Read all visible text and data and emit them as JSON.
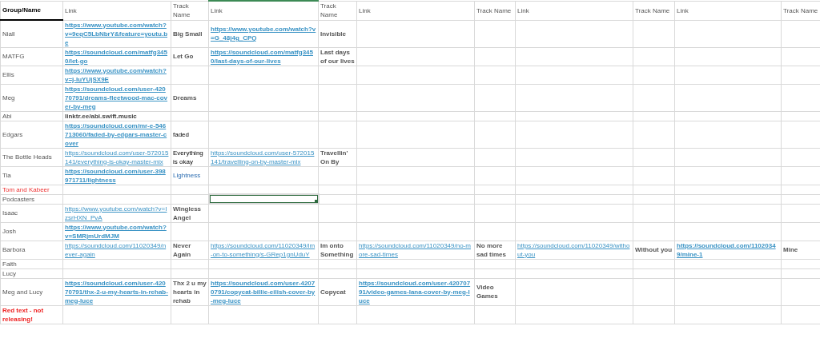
{
  "columns": [
    {
      "label": "Group/Name",
      "selected": false
    },
    {
      "label": "Link",
      "selected": false
    },
    {
      "label": "Track Name",
      "selected": false
    },
    {
      "label": "Link",
      "selected": true
    },
    {
      "label": "Track Name",
      "selected": false
    },
    {
      "label": "Link",
      "selected": false
    },
    {
      "label": "Track Name",
      "selected": false
    },
    {
      "label": "Link",
      "selected": false
    },
    {
      "label": "Track Name",
      "selected": false
    },
    {
      "label": "Link",
      "selected": false
    },
    {
      "label": "Track Name",
      "selected": false
    }
  ],
  "rows": [
    {
      "cells": [
        {
          "kind": "name",
          "text": "Niall",
          "selected": false
        },
        {
          "kind": "link_bold",
          "text": "https://www.youtube.com/watch?v=9eqC5LbNbrY&feature=youtu.be",
          "selected": false
        },
        {
          "kind": "track",
          "text": "Big Small",
          "selected": false
        },
        {
          "kind": "link_bold",
          "text": "https://www.youtube.com/watch?v=G_48j4g_CPQ",
          "selected": false
        },
        {
          "kind": "track",
          "text": "Invisible",
          "selected": false
        },
        {
          "kind": "empty",
          "selected": false
        },
        {
          "kind": "empty",
          "selected": false
        },
        {
          "kind": "empty",
          "selected": false
        },
        {
          "kind": "empty",
          "selected": false
        },
        {
          "kind": "empty",
          "selected": false
        },
        {
          "kind": "empty",
          "selected": false
        }
      ]
    },
    {
      "cells": [
        {
          "kind": "name",
          "text": "MATFG",
          "selected": false
        },
        {
          "kind": "link_bold",
          "text": "https://soundcloud.com/matfg3450/let-go",
          "selected": false
        },
        {
          "kind": "track",
          "text": "Let Go",
          "selected": false
        },
        {
          "kind": "link_bold",
          "text": "https://soundcloud.com/matfg3450/last-days-of-our-lives",
          "selected": false
        },
        {
          "kind": "track",
          "text": "Last days of our lives",
          "selected": false
        },
        {
          "kind": "empty",
          "selected": false
        },
        {
          "kind": "empty",
          "selected": false
        },
        {
          "kind": "empty",
          "selected": false
        },
        {
          "kind": "empty",
          "selected": false
        },
        {
          "kind": "empty",
          "selected": false
        },
        {
          "kind": "empty",
          "selected": false
        }
      ]
    },
    {
      "cells": [
        {
          "kind": "name",
          "text": "Ellis",
          "selected": false
        },
        {
          "kind": "link_bold",
          "text": "https://www.youtube.com/watch?v=j-IuYUjSX9E",
          "selected": false
        },
        {
          "kind": "empty",
          "selected": false
        },
        {
          "kind": "empty",
          "selected": false
        },
        {
          "kind": "empty",
          "selected": false
        },
        {
          "kind": "empty",
          "selected": false
        },
        {
          "kind": "empty",
          "selected": false
        },
        {
          "kind": "empty",
          "selected": false
        },
        {
          "kind": "empty",
          "selected": false
        },
        {
          "kind": "empty",
          "selected": false
        },
        {
          "kind": "empty",
          "selected": false
        }
      ]
    },
    {
      "cells": [
        {
          "kind": "name",
          "text": "Meg",
          "selected": false
        },
        {
          "kind": "link_bold",
          "text": "https://soundcloud.com/user-42070791/dreams-fleetwood-mac-cover-by-meg",
          "selected": false
        },
        {
          "kind": "track",
          "text": "Dreams",
          "selected": false
        },
        {
          "kind": "empty",
          "selected": false
        },
        {
          "kind": "empty",
          "selected": false
        },
        {
          "kind": "empty",
          "selected": false
        },
        {
          "kind": "empty",
          "selected": false
        },
        {
          "kind": "empty",
          "selected": false
        },
        {
          "kind": "empty",
          "selected": false
        },
        {
          "kind": "empty",
          "selected": false
        },
        {
          "kind": "empty",
          "selected": false
        }
      ]
    },
    {
      "cells": [
        {
          "kind": "name",
          "text": "Abi",
          "selected": false
        },
        {
          "kind": "text_bold",
          "text": "linktr.ee/abi.swift.music",
          "selected": false
        },
        {
          "kind": "empty",
          "selected": false
        },
        {
          "kind": "empty",
          "selected": false
        },
        {
          "kind": "empty",
          "selected": false
        },
        {
          "kind": "empty",
          "selected": false
        },
        {
          "kind": "empty",
          "selected": false
        },
        {
          "kind": "empty",
          "selected": false
        },
        {
          "kind": "empty",
          "selected": false
        },
        {
          "kind": "empty",
          "selected": false
        },
        {
          "kind": "empty",
          "selected": false
        }
      ]
    },
    {
      "cells": [
        {
          "kind": "name",
          "text": "Edgars",
          "selected": false
        },
        {
          "kind": "link_bold",
          "text": "https://soundcloud.com/mr-e-546713060/faded-by-edgars-master-cover",
          "selected": false
        },
        {
          "kind": "text",
          "text": "faded",
          "selected": false
        },
        {
          "kind": "empty",
          "selected": false
        },
        {
          "kind": "empty",
          "selected": false
        },
        {
          "kind": "empty",
          "selected": false
        },
        {
          "kind": "empty",
          "selected": false
        },
        {
          "kind": "empty",
          "selected": false
        },
        {
          "kind": "empty",
          "selected": false
        },
        {
          "kind": "empty",
          "selected": false
        },
        {
          "kind": "empty",
          "selected": false
        }
      ]
    },
    {
      "cells": [
        {
          "kind": "name",
          "text": "The Bottle Heads",
          "selected": false
        },
        {
          "kind": "link",
          "text": "https://soundcloud.com/user-572015141/everything-is-okay-master-mix",
          "selected": false
        },
        {
          "kind": "text",
          "text": "Everything is okay",
          "selected": false
        },
        {
          "kind": "link",
          "text": "https://soundcloud.com/user-572015141/travelling-on-by-master-mix",
          "selected": false
        },
        {
          "kind": "track",
          "text": "Travellin' On By",
          "selected": false
        },
        {
          "kind": "empty",
          "selected": false
        },
        {
          "kind": "empty",
          "selected": false
        },
        {
          "kind": "empty",
          "selected": false
        },
        {
          "kind": "empty",
          "selected": false
        },
        {
          "kind": "empty",
          "selected": false
        },
        {
          "kind": "empty",
          "selected": false
        }
      ]
    },
    {
      "cells": [
        {
          "kind": "name",
          "text": "Tia",
          "selected": false
        },
        {
          "kind": "link_bold",
          "text": "https://soundcloud.com/user-398971711/lightness",
          "selected": false
        },
        {
          "kind": "text_blue",
          "text": "Lightness",
          "selected": false
        },
        {
          "kind": "empty",
          "selected": false
        },
        {
          "kind": "empty",
          "selected": false
        },
        {
          "kind": "empty",
          "selected": false
        },
        {
          "kind": "empty",
          "selected": false
        },
        {
          "kind": "empty",
          "selected": false
        },
        {
          "kind": "empty",
          "selected": false
        },
        {
          "kind": "empty",
          "selected": false
        },
        {
          "kind": "empty",
          "selected": false
        }
      ]
    },
    {
      "cells": [
        {
          "kind": "name_red",
          "text": "Tom and Kabeer",
          "selected": false
        },
        {
          "kind": "empty",
          "selected": false
        },
        {
          "kind": "empty",
          "selected": false
        },
        {
          "kind": "empty",
          "selected": false
        },
        {
          "kind": "empty",
          "selected": false
        },
        {
          "kind": "empty",
          "selected": false
        },
        {
          "kind": "empty",
          "selected": false
        },
        {
          "kind": "empty",
          "selected": false
        },
        {
          "kind": "empty",
          "selected": false
        },
        {
          "kind": "empty",
          "selected": false
        },
        {
          "kind": "empty",
          "selected": false
        }
      ]
    },
    {
      "cells": [
        {
          "kind": "name",
          "text": "Podcasters",
          "selected": false
        },
        {
          "kind": "empty",
          "selected": false
        },
        {
          "kind": "empty",
          "selected": false
        },
        {
          "kind": "empty",
          "selected": true
        },
        {
          "kind": "empty",
          "selected": false
        },
        {
          "kind": "empty",
          "selected": false
        },
        {
          "kind": "empty",
          "selected": false
        },
        {
          "kind": "empty",
          "selected": false
        },
        {
          "kind": "empty",
          "selected": false
        },
        {
          "kind": "empty",
          "selected": false
        },
        {
          "kind": "empty",
          "selected": false
        }
      ]
    },
    {
      "cells": [
        {
          "kind": "name",
          "text": "Isaac",
          "selected": false
        },
        {
          "kind": "link",
          "text": "https://www.youtube.com/watch?v=IzsrHXN_PvA",
          "selected": false
        },
        {
          "kind": "track",
          "text": "Wingless Angel",
          "selected": false
        },
        {
          "kind": "empty",
          "selected": false
        },
        {
          "kind": "empty",
          "selected": false
        },
        {
          "kind": "empty",
          "selected": false
        },
        {
          "kind": "empty",
          "selected": false
        },
        {
          "kind": "empty",
          "selected": false
        },
        {
          "kind": "empty",
          "selected": false
        },
        {
          "kind": "empty",
          "selected": false
        },
        {
          "kind": "empty",
          "selected": false
        }
      ]
    },
    {
      "cells": [
        {
          "kind": "name",
          "text": "Josh",
          "selected": false
        },
        {
          "kind": "link_bold",
          "text": "https://www.youtube.com/watch?v=SMRjmUrdMJM",
          "selected": false
        },
        {
          "kind": "empty",
          "selected": false
        },
        {
          "kind": "empty",
          "selected": false
        },
        {
          "kind": "empty",
          "selected": false
        },
        {
          "kind": "empty",
          "selected": false
        },
        {
          "kind": "empty",
          "selected": false
        },
        {
          "kind": "empty",
          "selected": false
        },
        {
          "kind": "empty",
          "selected": false
        },
        {
          "kind": "empty",
          "selected": false
        },
        {
          "kind": "empty",
          "selected": false
        }
      ]
    },
    {
      "cells": [
        {
          "kind": "name",
          "text": "Barbora",
          "selected": false
        },
        {
          "kind": "link",
          "text": "https://soundcloud.com/11020349/never-again",
          "selected": false
        },
        {
          "kind": "track",
          "text": "Never Again",
          "selected": false
        },
        {
          "kind": "link",
          "text": "https://soundcloud.com/11020349/im-on-to-something/s-GRep1gnUduY",
          "selected": false
        },
        {
          "kind": "track",
          "text": "Im onto Something",
          "selected": false
        },
        {
          "kind": "link",
          "text": "https://soundcloud.com/11020349/no-more-sad-times",
          "selected": false
        },
        {
          "kind": "track",
          "text": "No more sad times",
          "selected": false
        },
        {
          "kind": "link",
          "text": "https://soundcloud.com/11020349/without-you",
          "selected": false
        },
        {
          "kind": "track",
          "text": "Without you",
          "selected": false
        },
        {
          "kind": "link_bold",
          "text": "https://soundcloud.com/11020349/mine-1",
          "selected": false
        },
        {
          "kind": "track",
          "text": "Mine",
          "selected": false
        }
      ]
    },
    {
      "cells": [
        {
          "kind": "name",
          "text": "Faith",
          "selected": false
        },
        {
          "kind": "empty",
          "selected": false
        },
        {
          "kind": "empty",
          "selected": false
        },
        {
          "kind": "empty",
          "selected": false
        },
        {
          "kind": "empty",
          "selected": false
        },
        {
          "kind": "empty",
          "selected": false
        },
        {
          "kind": "empty",
          "selected": false
        },
        {
          "kind": "empty",
          "selected": false
        },
        {
          "kind": "empty",
          "selected": false
        },
        {
          "kind": "empty",
          "selected": false
        },
        {
          "kind": "empty",
          "selected": false
        }
      ]
    },
    {
      "cells": [
        {
          "kind": "name",
          "text": "Lucy",
          "selected": false
        },
        {
          "kind": "empty",
          "selected": false
        },
        {
          "kind": "empty",
          "selected": false
        },
        {
          "kind": "empty",
          "selected": false
        },
        {
          "kind": "empty",
          "selected": false
        },
        {
          "kind": "empty",
          "selected": false
        },
        {
          "kind": "empty",
          "selected": false
        },
        {
          "kind": "empty",
          "selected": false
        },
        {
          "kind": "empty",
          "selected": false
        },
        {
          "kind": "empty",
          "selected": false
        },
        {
          "kind": "empty",
          "selected": false
        }
      ]
    },
    {
      "cells": [
        {
          "kind": "name",
          "text": "Meg and Lucy",
          "selected": false
        },
        {
          "kind": "link_bold",
          "text": "https://soundcloud.com/user-42070791/thx-2-u-my-hearts-in-rehab-meg-luce",
          "selected": false
        },
        {
          "kind": "track",
          "text": "Thx 2 u my hearts in rehab",
          "selected": false
        },
        {
          "kind": "link_bold",
          "text": "https://soundcloud.com/user-42070791/copycat-billie-eilish-cover-by-meg-luce",
          "selected": false
        },
        {
          "kind": "track",
          "text": "Copycat",
          "selected": false
        },
        {
          "kind": "link_bold",
          "text": "https://soundcloud.com/user-42070791/video-games-lana-cover-by-meg-luce",
          "selected": false
        },
        {
          "kind": "track",
          "text": "Video Games",
          "selected": false
        },
        {
          "kind": "empty",
          "selected": false
        },
        {
          "kind": "empty",
          "selected": false
        },
        {
          "kind": "empty",
          "selected": false
        },
        {
          "kind": "empty",
          "selected": false
        }
      ]
    },
    {
      "cells": [
        {
          "kind": "name_red_bold",
          "text": "Red text - not releasing!",
          "selected": false
        },
        {
          "kind": "empty",
          "selected": false
        },
        {
          "kind": "empty",
          "selected": false
        },
        {
          "kind": "empty",
          "selected": false
        },
        {
          "kind": "empty",
          "selected": false
        },
        {
          "kind": "empty",
          "selected": false
        },
        {
          "kind": "empty",
          "selected": false
        },
        {
          "kind": "empty",
          "selected": false
        },
        {
          "kind": "empty",
          "selected": false
        },
        {
          "kind": "empty",
          "selected": false
        },
        {
          "kind": "empty",
          "selected": false
        }
      ]
    }
  ]
}
